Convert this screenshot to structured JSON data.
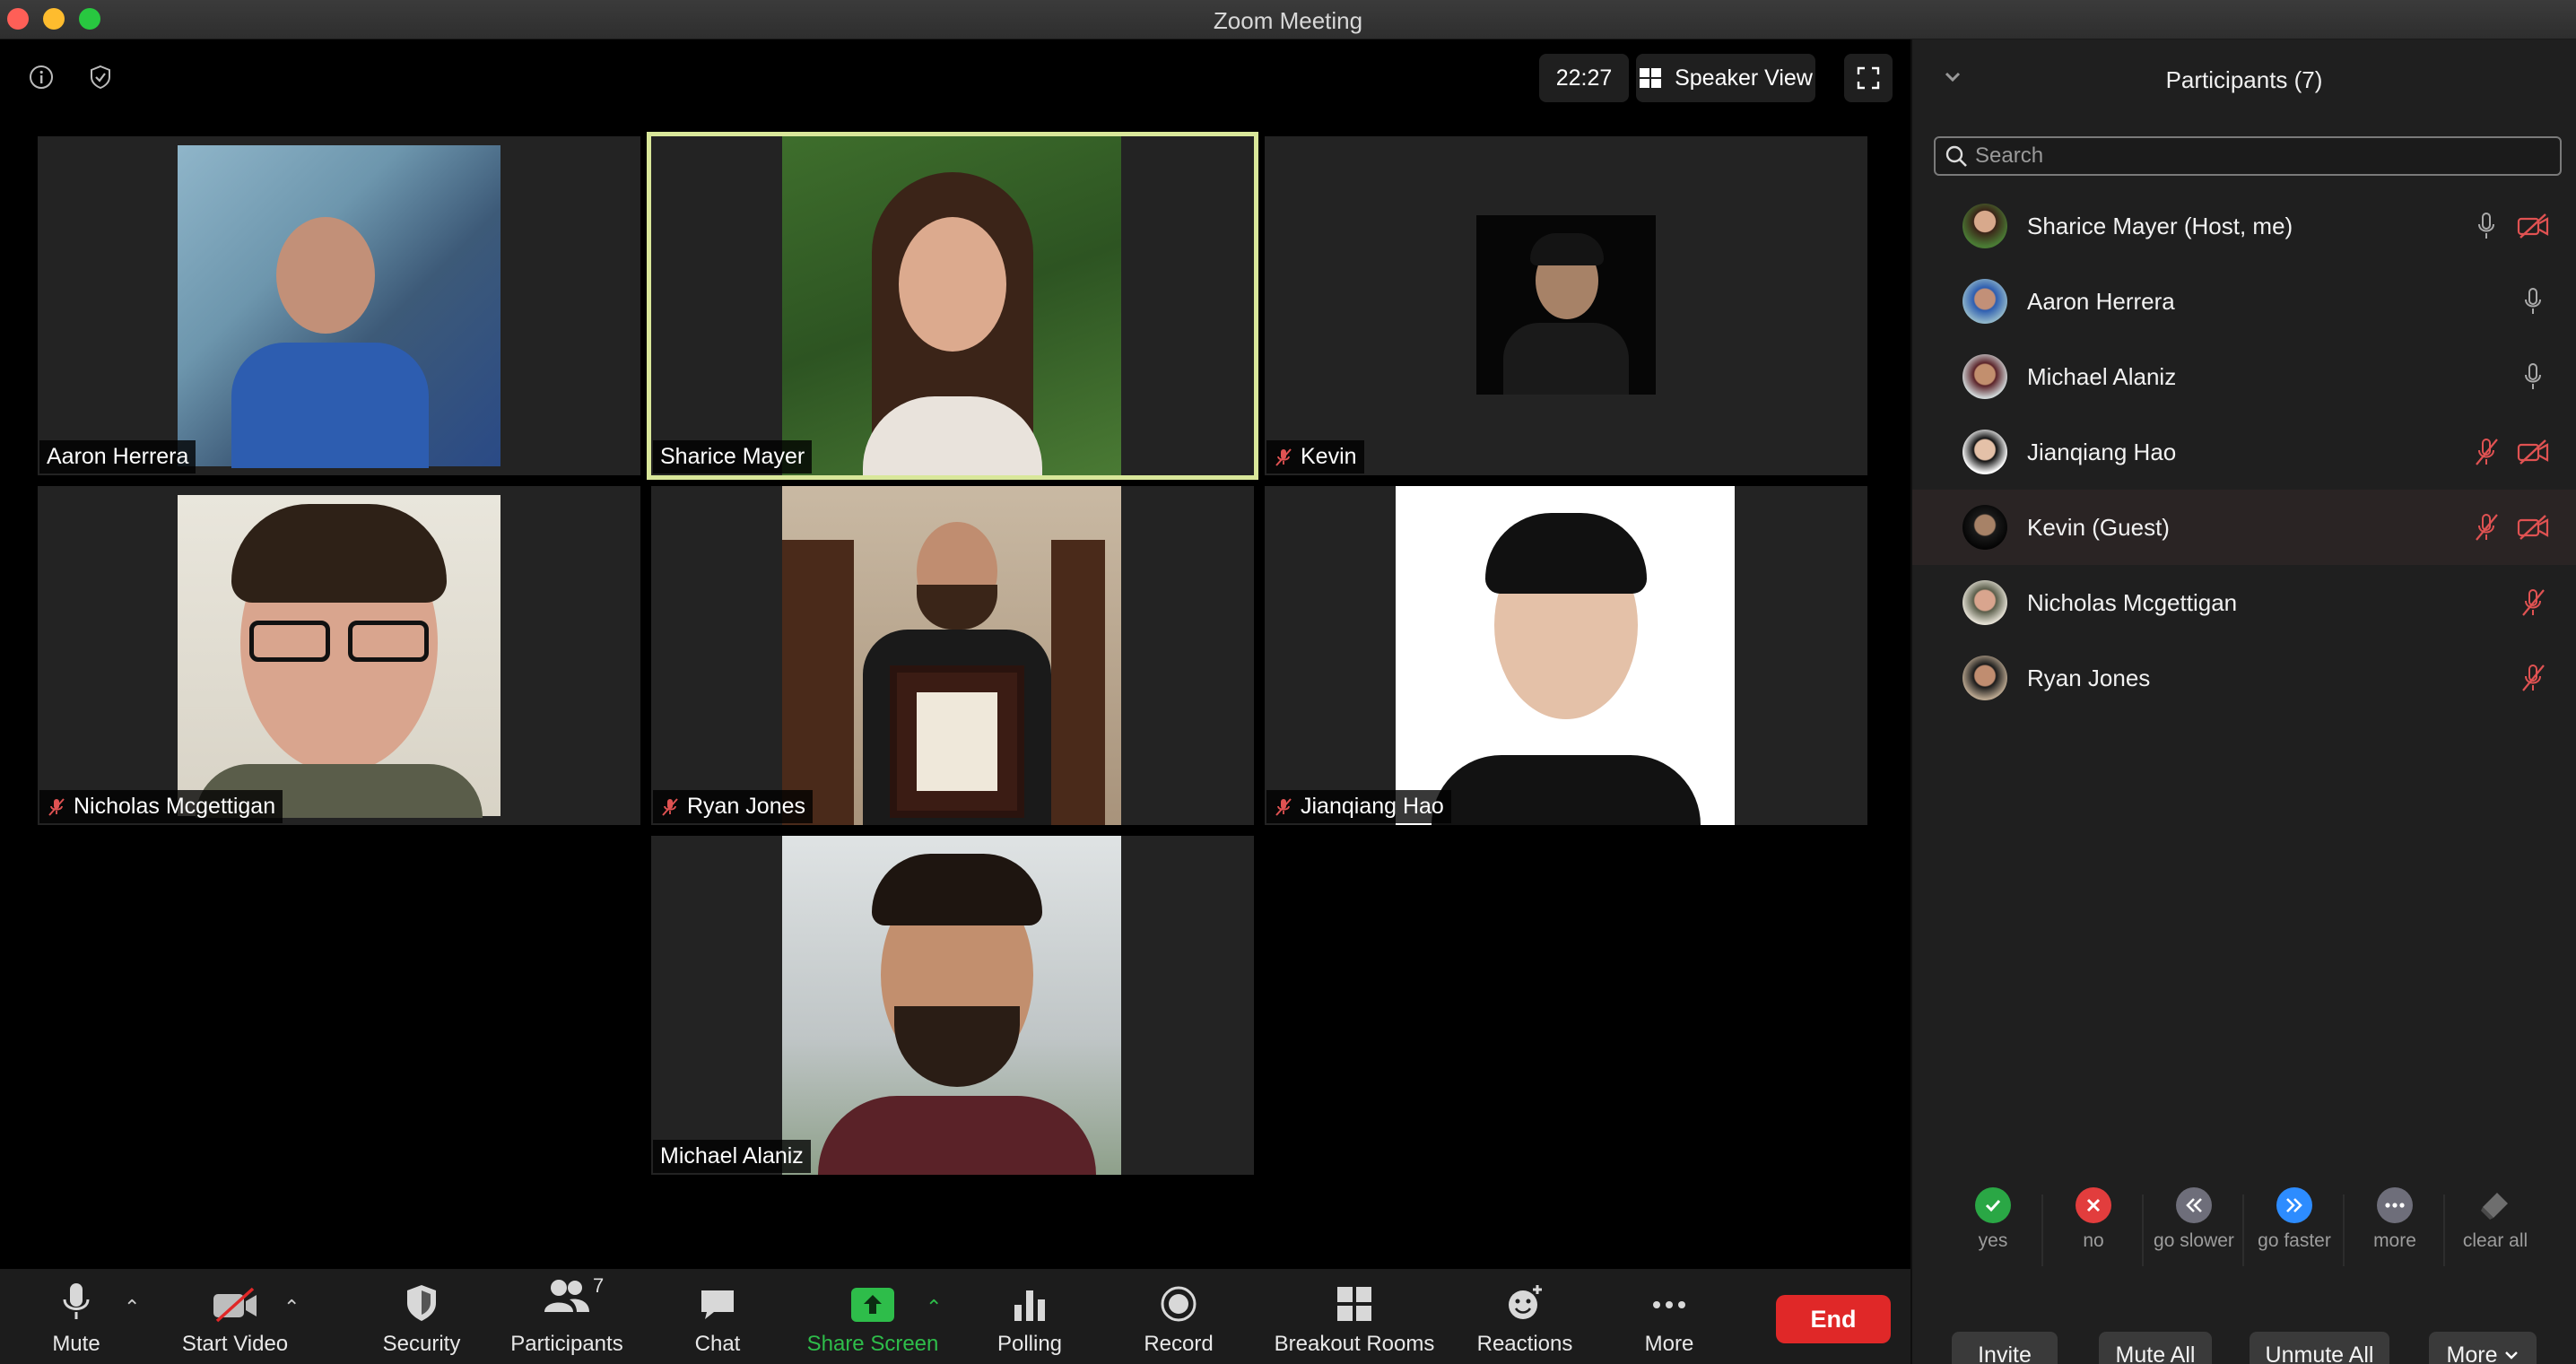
{
  "window": {
    "title": "Zoom Meeting"
  },
  "top_bar": {
    "timer": "22:27",
    "view_label": "Speaker View"
  },
  "tiles": [
    {
      "name": "Aaron Herrera",
      "muted": false
    },
    {
      "name": "Sharice Mayer",
      "muted": false,
      "active_speaker": true
    },
    {
      "name": "Kevin",
      "muted": true
    },
    {
      "name": "Nicholas Mcgettigan",
      "muted": true
    },
    {
      "name": "Ryan Jones",
      "muted": true
    },
    {
      "name": "Jianqiang Hao",
      "muted": true
    },
    {
      "name": "Michael Alaniz",
      "muted": false
    }
  ],
  "toolbar": {
    "mute": "Mute",
    "start_video": "Start Video",
    "security": "Security",
    "participants": "Participants",
    "participants_count": "7",
    "chat": "Chat",
    "share_screen": "Share Screen",
    "polling": "Polling",
    "record": "Record",
    "breakout_rooms": "Breakout Rooms",
    "reactions": "Reactions",
    "more": "More",
    "end": "End"
  },
  "panel": {
    "title": "Participants (7)",
    "search_placeholder": "Search",
    "participants": [
      {
        "name": "Sharice Mayer (Host, me)",
        "mic": "on",
        "video": "off"
      },
      {
        "name": "Aaron Herrera",
        "mic": "on",
        "video": "none"
      },
      {
        "name": "Michael Alaniz",
        "mic": "on",
        "video": "none"
      },
      {
        "name": "Jianqiang Hao",
        "mic": "muted",
        "video": "off"
      },
      {
        "name": "Kevin (Guest)",
        "mic": "muted",
        "video": "off"
      },
      {
        "name": "Nicholas Mcgettigan",
        "mic": "muted",
        "video": "none"
      },
      {
        "name": "Ryan Jones",
        "mic": "muted",
        "video": "none"
      }
    ],
    "feedback": [
      {
        "label": "yes",
        "color": "#2aa745"
      },
      {
        "label": "no",
        "color": "#e23d3d"
      },
      {
        "label": "go slower",
        "color": "#6e6e7a"
      },
      {
        "label": "go faster",
        "color": "#2d8cff"
      },
      {
        "label": "more",
        "color": "#6e6e7a"
      },
      {
        "label": "clear all",
        "color": "#6e6e6e"
      }
    ],
    "buttons": {
      "invite": "Invite",
      "mute_all": "Mute All",
      "unmute_all": "Unmute All",
      "more": "More"
    }
  },
  "colors": {
    "accent_green": "#2ebd4a",
    "end_red": "#e02828",
    "active_outline": "#d9e79a",
    "muted_red": "#e05252"
  }
}
